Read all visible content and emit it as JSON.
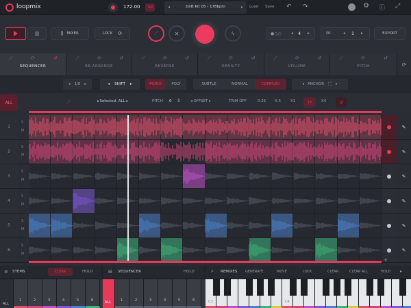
{
  "app": {
    "name": "loopmix",
    "tempo": "172.00",
    "tap_label": "TAP",
    "kit_name": "DnB Kit 05 - 178bpm",
    "load_label": "Load",
    "save_label": "Save"
  },
  "toolbar": {
    "mixer_label": "MIXER",
    "lock_label": "LOCK",
    "pattern_count": "4",
    "loop_count": "1",
    "export_label": "EXPORT"
  },
  "tabs": [
    {
      "label": "SEQUENCER"
    },
    {
      "label": "RE-ARRANGE"
    },
    {
      "label": "REVERSE"
    },
    {
      "label": "DENSITY"
    },
    {
      "label": "VOLUME"
    },
    {
      "label": "PITCH"
    }
  ],
  "controls": {
    "division": "1/8",
    "shift_label": "SHIFT",
    "mono_label": "MONO",
    "poly_label": "POLY",
    "subtle_label": "SUBTLE",
    "normal_label": "NORMAL",
    "complex_label": "COMPLEX",
    "anchor_label": "ANCHOR"
  },
  "controls2": {
    "all_label": "ALL",
    "selected_label": "Selected: ALL",
    "pitch_label": "PITCH",
    "pitch_value": "0",
    "offset_label": "OFFSET",
    "trim_label": "TRIM OFF",
    "speeds": [
      "0.25",
      "X.5",
      "X1",
      "1X",
      "X4"
    ]
  },
  "tracks": [
    {
      "num": "1",
      "s": "S",
      "m": "M",
      "color": "#e0506e"
    },
    {
      "num": "2",
      "s": "S",
      "m": "M",
      "color": "#d6457a"
    },
    {
      "num": "3",
      "s": "S",
      "m": "M",
      "color": "#c050c8"
    },
    {
      "num": "4",
      "s": "S",
      "m": "M",
      "color": "#7a5ad0"
    },
    {
      "num": "5",
      "s": "S",
      "m": "M",
      "color": "#4d7fc9"
    },
    {
      "num": "6",
      "s": "S",
      "m": "M",
      "color": "#3fb37a"
    }
  ],
  "bottom": {
    "stems_label": "STEMS",
    "clear_label": "CLEAR",
    "hold_label": "HOLD",
    "sequencer_label": "SEQUENCER",
    "seq_hold": "HOLD",
    "remixes_label": "REMIXES",
    "generate_label": "GENERATE",
    "move_label": "MOVE",
    "lock_label": "LOCK",
    "clear2_label": "CLEAR",
    "clear_all_label": "CLEAR ALL",
    "hold2_label": "HOLD",
    "all_label": "ALL",
    "seq_all_label": "ALL",
    "stem_keys": [
      "1",
      "2",
      "3",
      "4",
      "5",
      "6"
    ],
    "seq_keys": [
      "1",
      "2",
      "3",
      "4",
      "5",
      "6"
    ],
    "c3_label": "C3",
    "c4_label": "C4"
  },
  "colors": {
    "accent": "#e8395b",
    "bg": "#2a2d34",
    "panel": "#1f2227"
  }
}
